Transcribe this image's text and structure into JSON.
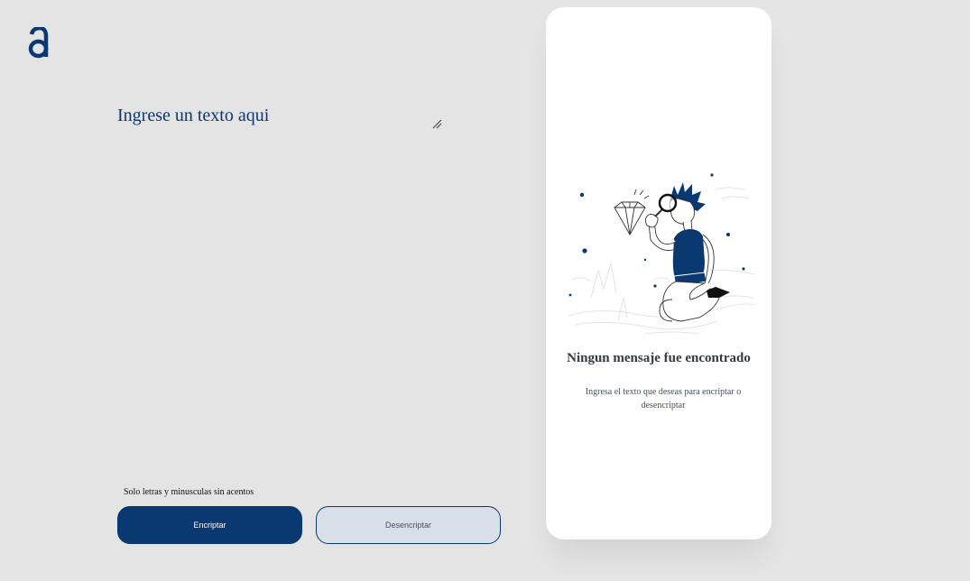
{
  "logo": {
    "icon": "alura-logo-icon",
    "color": "#0a3871"
  },
  "input": {
    "placeholder": "Ingrese un texto aqui",
    "value": ""
  },
  "hint": {
    "icon": "info-icon",
    "text": "Solo letras y minusculas sin acentos"
  },
  "buttons": {
    "encrypt_label": "Encriptar",
    "decrypt_label": "Desencriptar"
  },
  "output": {
    "illustration": "person-with-magnifying-glass-illustration",
    "title": "Ningun mensaje fue encontrado",
    "description": "Ingresa el texto que deseas para encriptar o desencriptar"
  },
  "colors": {
    "background": "#e4e4e4",
    "primary": "#0a3871",
    "secondary_button": "#d8dfe8",
    "card": "#ffffff"
  }
}
